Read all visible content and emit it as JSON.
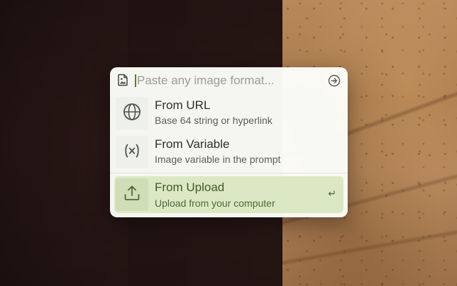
{
  "search": {
    "placeholder": "Paste any image format..."
  },
  "icons": {
    "leading": "image-file-icon",
    "submit": "arrow-circle-right-icon",
    "url": "globe-icon",
    "variable": "variable-x-icon",
    "upload": "upload-icon",
    "enter": "enter-key-icon"
  },
  "options": [
    {
      "title": "From URL",
      "subtitle": "Base 64 string or hyperlink"
    },
    {
      "title": "From Variable",
      "subtitle": "Image variable in the prompt"
    },
    {
      "title": "From Upload",
      "subtitle": "Upload from your computer",
      "selected": true
    }
  ],
  "shortcut_glyph": "↵",
  "colors": {
    "accent": "#5a7d3e",
    "selected_bg": "#dce8c4",
    "panel_bg": "#fcfdf9"
  }
}
